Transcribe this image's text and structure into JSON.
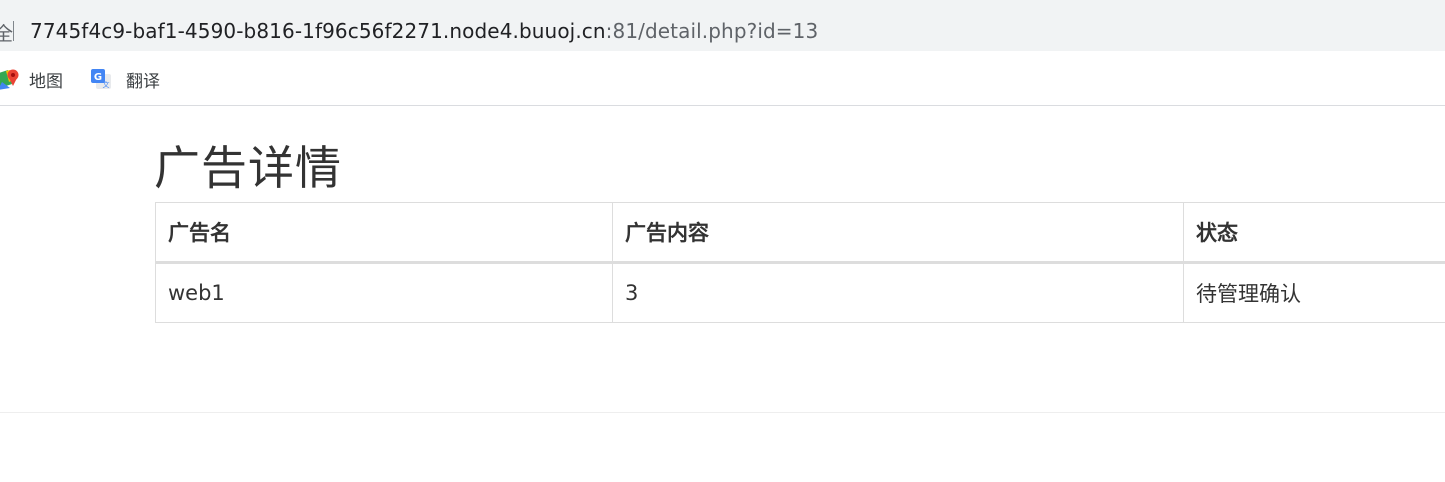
{
  "browser": {
    "secure_fragment": "全",
    "url_host": "7745f4c9-baf1-4590-b816-1f96c56f2271.node4.buuoj.cn",
    "url_rest": ":81/detail.php?id=13",
    "bookmarks": [
      {
        "label": "地图",
        "icon": "maps-icon"
      },
      {
        "label": "翻译",
        "icon": "translate-icon"
      }
    ]
  },
  "page": {
    "title": "广告详情",
    "table": {
      "headers": [
        "广告名",
        "广告内容",
        "状态"
      ],
      "rows": [
        [
          "web1",
          "3",
          "待管理确认"
        ]
      ]
    }
  }
}
